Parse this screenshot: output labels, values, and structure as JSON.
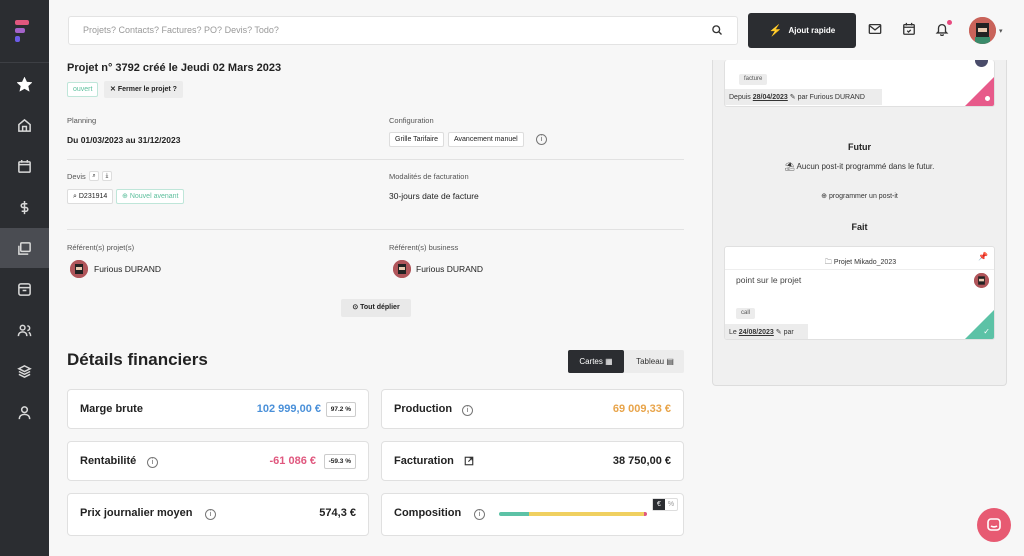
{
  "search": {
    "placeholder": "Projets? Contacts? Factures? PO? Devis? Todo?"
  },
  "quick_add": {
    "label": "Ajout rapide"
  },
  "project": {
    "title": "Projet n° 3792 créé le Jeudi 02 Mars 2023",
    "status": "ouvert",
    "close_label": "Fermer le projet ?",
    "planning_label": "Planning",
    "planning_value": "Du 01/03/2023 au 31/12/2023",
    "config_label": "Configuration",
    "config_chips": [
      "Grille Tarifaire",
      "Avancement manuel"
    ],
    "devis_label": "Devis",
    "devis_ref": "D231914",
    "new_amendment": "Nouvel avenant",
    "billing_label": "Modalités de facturation",
    "billing_value": "30-jours date de facture",
    "project_refs_label": "Référent(s) projet(s)",
    "project_ref_name": "Furious DURAND",
    "business_refs_label": "Référent(s) business",
    "business_ref_name": "Furious DURAND",
    "unfold_label": "Tout déplier"
  },
  "financials": {
    "title": "Détails financiers",
    "view_cards": "Cartes",
    "view_table": "Tableau",
    "cards": [
      {
        "title": "Marge brute",
        "value": "102 999,00 €",
        "pct": "97.2 %",
        "color": "#4a90d9"
      },
      {
        "title": "Production",
        "value": "69 009,33 €",
        "color": "#e8a44a"
      },
      {
        "title": "Rentabilité",
        "value": "-61 086 €",
        "pct": "-59.3 %",
        "color": "#e0577e"
      },
      {
        "title": "Facturation",
        "value": "38 750,00 €",
        "color": "#222222"
      },
      {
        "title": "Prix journalier moyen",
        "value": "574,3 €",
        "color": "#222222"
      },
      {
        "title": "Composition",
        "value": "",
        "color": "#222222"
      }
    ],
    "composition_toggle": [
      "€",
      "%"
    ],
    "composition_segments": [
      {
        "fraction": 0.2,
        "color": "#5cc2a6"
      },
      {
        "fraction": 0.78,
        "color": "#f0d060"
      },
      {
        "fraction": 0.02,
        "color": "#e0577e"
      }
    ]
  },
  "postits": {
    "top_tag": "facture",
    "top_foot_prefix": "Depuis",
    "top_foot_date": "28/04/2023",
    "top_foot_author": "par Furious DURAND",
    "futur_title": "Futur",
    "futur_empty": "Aucun post-it programmé dans le futur.",
    "futur_action": "programmer un post-it",
    "done_title": "Fait",
    "done_project": "Projet Mikado_2023",
    "done_text": "point sur le projet",
    "done_tag": "call",
    "done_foot_prefix": "Le",
    "done_foot_date": "24/08/2023",
    "done_foot_author": "par"
  }
}
